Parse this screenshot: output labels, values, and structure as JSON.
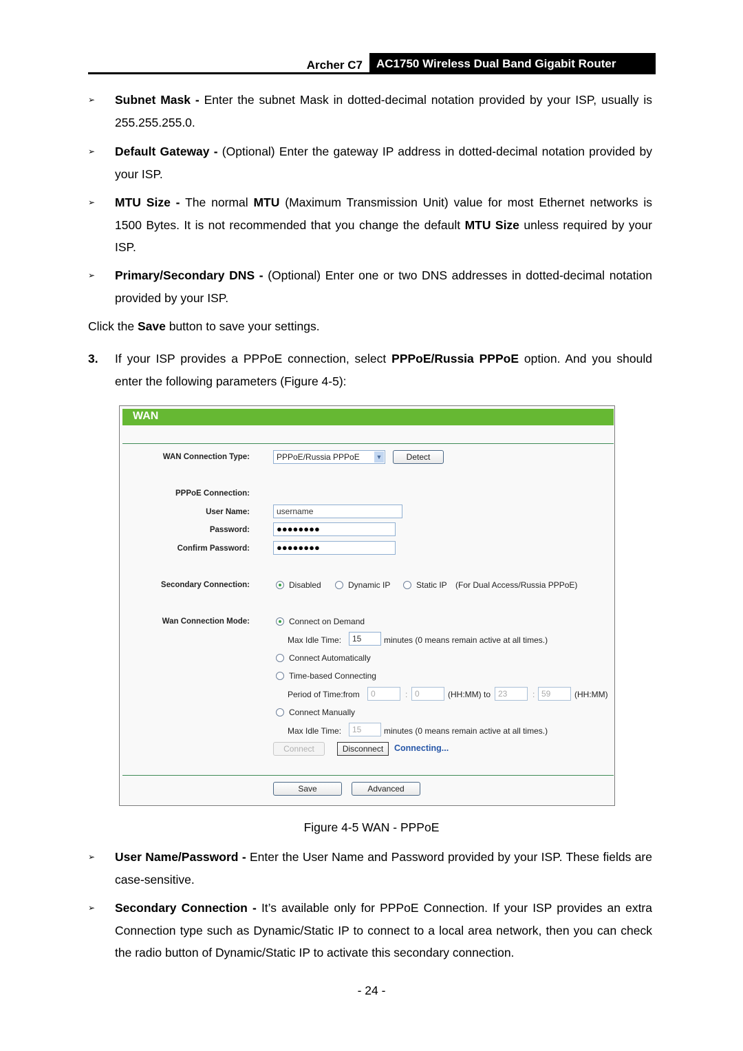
{
  "header": {
    "model": "Archer C7",
    "product": "AC1750 Wireless Dual Band Gigabit Router"
  },
  "bullets_top": [
    {
      "bold": "Subnet Mask -",
      "text": " Enter the subnet Mask in dotted-decimal notation provided by your ISP, usually is 255.255.255.0."
    },
    {
      "bold": "Default Gateway -",
      "text": " (Optional) Enter the gateway IP address in dotted-decimal notation provided by your ISP."
    },
    {
      "bold": "MTU Size -",
      "t1": " The normal ",
      "b2": "MTU",
      "t2": " (Maximum Transmission Unit) value for most Ethernet networks is 1500 Bytes. It is not recommended that you change the default ",
      "b3": "MTU Size",
      "t3": " unless required by your ISP."
    },
    {
      "bold": "Primary/Secondary DNS -",
      "text": " (Optional) Enter one or two DNS addresses in dotted-decimal notation provided by your ISP."
    }
  ],
  "save_note": {
    "t1": "Click the ",
    "b": "Save",
    "t2": " button to save your settings."
  },
  "step3": {
    "num": "3.",
    "t1": "If your ISP provides a PPPoE connection, select ",
    "b": "PPPoE/Russia PPPoE",
    "t2": " option. And you should enter the following parameters (Figure 4-5):"
  },
  "figure": {
    "title": "WAN",
    "conn_type_label": "WAN Connection Type:",
    "conn_type_value": "PPPoE/Russia PPPoE",
    "detect_btn": "Detect",
    "pppoe_label": "PPPoE Connection:",
    "user_label": "User Name:",
    "user_value": "username",
    "pass_label": "Password:",
    "pass_value": "●●●●●●●●",
    "confirm_label": "Confirm Password:",
    "confirm_value": "●●●●●●●●",
    "secondary_label": "Secondary Connection:",
    "secondary_options": [
      "Disabled",
      "Dynamic IP",
      "Static IP"
    ],
    "secondary_selected": "Disabled",
    "secondary_note": "(For Dual Access/Russia PPPoE)",
    "mode_label": "Wan Connection Mode:",
    "mode_options": [
      "Connect on Demand",
      "Connect Automatically",
      "Time-based Connecting",
      "Connect Manually"
    ],
    "mode_selected": "Connect on Demand",
    "max_idle_label": "Max Idle Time:",
    "max_idle_value": "15",
    "max_idle_unit": "minutes (0 means remain active at all times.)",
    "period_label": "Period of Time:from",
    "period_from_h": "0",
    "period_from_m": "0",
    "colon": ":",
    "hhmm_to": "(HH:MM) to",
    "period_to_h": "23",
    "period_to_m": "59",
    "hhmm": "(HH:MM)",
    "manual_idle_value": "15",
    "connect_btn": "Connect",
    "disconnect_btn": "Disconnect",
    "status": "Connecting...",
    "save_btn": "Save",
    "advanced_btn": "Advanced"
  },
  "caption": "Figure 4-5 WAN - PPPoE",
  "bullets_bottom": [
    {
      "bold": "User Name/Password -",
      "text": " Enter the User Name and Password provided by your ISP. These fields are case-sensitive."
    },
    {
      "bold": "Secondary Connection -",
      "text": " It’s available only for PPPoE Connection. If your ISP provides an extra Connection type such as Dynamic/Static IP to connect to a local area network, then you can check the radio button of Dynamic/Static IP to activate this secondary connection."
    }
  ],
  "bullet_glyph": "➢",
  "page_number": "- 24 -"
}
